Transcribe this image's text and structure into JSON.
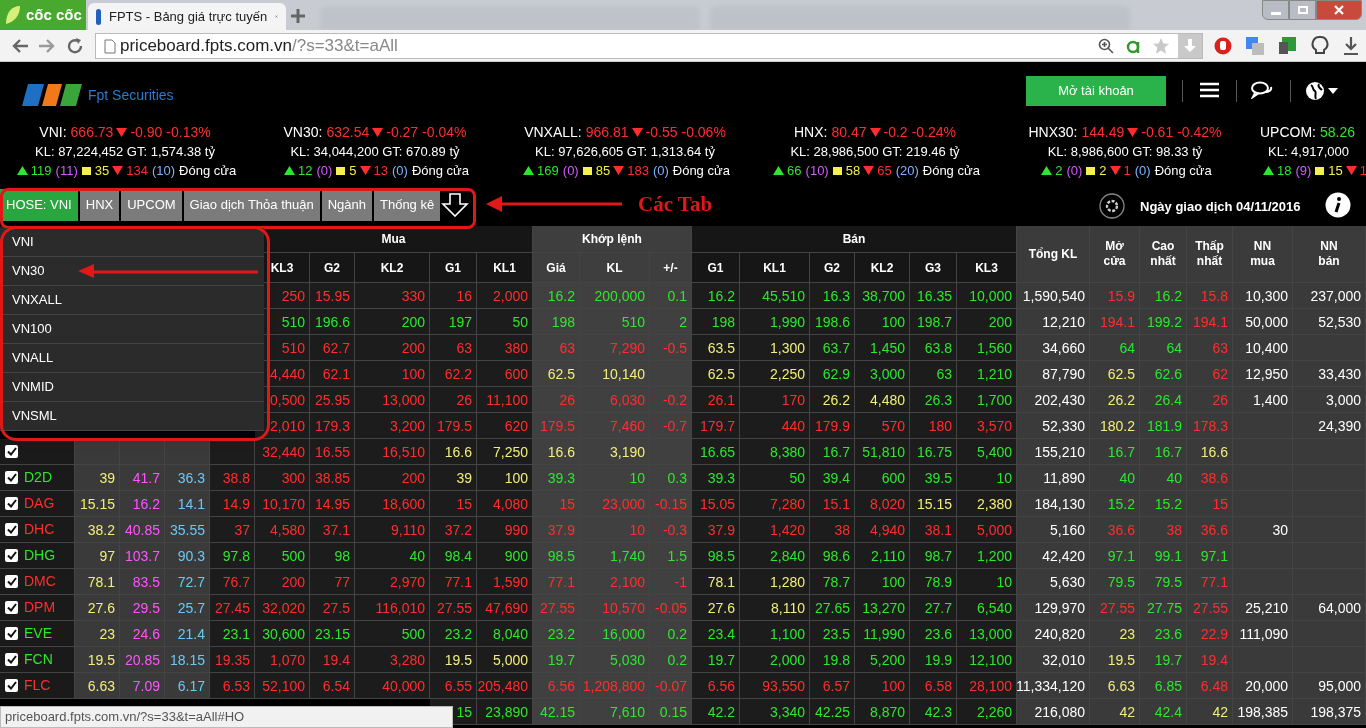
{
  "browser": {
    "logo_text": "cốc cốc",
    "tab_title": "FPTS - Bảng giá trực tuyến",
    "url_host": "priceboard.fpts.com.vn",
    "url_path": "/?s=33&t=aAll"
  },
  "header": {
    "logo_text": "Fpt Securities",
    "open_account": "Mở tài khoản"
  },
  "indices": [
    {
      "name": "VNI:",
      "value": "666.73",
      "rising": false,
      "change": "-0.90",
      "percent": "-0.13%",
      "volume_line": "KL: 87,224,452 GT: 1,574.38 tỷ",
      "advances": "119",
      "ceiling_count": "(11)",
      "unchanged": "35",
      "declines": "134",
      "floor_count": "(10)",
      "session": "Đóng cửa"
    },
    {
      "name": "VN30:",
      "value": "632.54",
      "rising": false,
      "change": "-0.27",
      "percent": "-0.04%",
      "volume_line": "KL: 34,044,200 GT: 670.89 tỷ",
      "advances": "12",
      "ceiling_count": "(0)",
      "unchanged": "5",
      "declines": "13",
      "floor_count": "(0)",
      "session": "Đóng cửa"
    },
    {
      "name": "VNXALL:",
      "value": "966.81",
      "rising": false,
      "change": "-0.55",
      "percent": "-0.06%",
      "volume_line": "KL: 97,626,605 GT: 1,313.64 tỷ",
      "advances": "169",
      "ceiling_count": "(0)",
      "unchanged": "85",
      "declines": "183",
      "floor_count": "(0)",
      "session": "Đóng cửa"
    },
    {
      "name": "HNX:",
      "value": "80.47",
      "rising": false,
      "change": "-0.2",
      "percent": "-0.24%",
      "volume_line": "KL: 28,986,500 GT: 219.46 tỷ",
      "advances": "66",
      "ceiling_count": "(10)",
      "unchanged": "58",
      "declines": "65",
      "floor_count": "(20)",
      "session": "Đóng cửa"
    },
    {
      "name": "HNX30:",
      "value": "144.49",
      "rising": false,
      "change": "-0.61",
      "percent": "-0.42%",
      "volume_line": "KL: 8,986,600 GT: 98.33 tỷ",
      "advances": "2",
      "ceiling_count": "(0)",
      "unchanged": "2",
      "declines": "1",
      "floor_count": "(0)",
      "session": "Đóng cửa"
    },
    {
      "name": "UPCOM:",
      "value": "58.26",
      "rising": true,
      "volume_line": "KL: 4,917,000",
      "advances": "18",
      "ceiling_count": "(9)",
      "unchanged": "15",
      "declines": "1"
    }
  ],
  "tabs": [
    {
      "label": "HOSE: VNI",
      "selected": true
    },
    {
      "label": "HNX",
      "selected": false
    },
    {
      "label": "UPCOM",
      "selected": false
    },
    {
      "label": "Giao dịch Thỏa thuận",
      "selected": false
    },
    {
      "label": "Ngành",
      "selected": false
    },
    {
      "label": "Thống kê",
      "selected": false
    }
  ],
  "annotation": "Các Tab",
  "trading_date": "Ngày giao dịch 04/11/2016",
  "dropdown": [
    "VNI",
    "VN30",
    "VNXALL",
    "VN100",
    "VNALL",
    "VNMID",
    "VNSML"
  ],
  "table": {
    "groups": [
      "Mua",
      "Khớp lệnh",
      "Bán"
    ],
    "columns": [
      null,
      null,
      null,
      null,
      "KL3",
      "G2",
      "KL2",
      "G1",
      "KL1",
      "Giá",
      "KL",
      "+/-",
      "G1",
      "KL1",
      "G2",
      "KL2",
      "G3",
      "KL3",
      "Tổng KL",
      "Mở cửa",
      "Cao nhất",
      "Thấp nhất",
      "NN mua",
      "NN bán"
    ],
    "rows": [
      {
        "cells": [
          null,
          null,
          null,
          null,
          {
            "text": "250",
            "color": "#ff2e2e"
          },
          {
            "text": "15.95",
            "color": "#ff2e2e"
          },
          {
            "text": "330",
            "color": "#ff2e2e"
          },
          {
            "text": "16",
            "color": "#ff2e2e"
          },
          {
            "text": "2,000",
            "color": "#ff2e2e"
          },
          {
            "text": "16.2",
            "color": "#2ee62e"
          },
          {
            "text": "200,000",
            "color": "#2ee62e"
          },
          {
            "text": "0.1",
            "color": "#2ee62e"
          },
          {
            "text": "16.2",
            "color": "#2ee62e"
          },
          {
            "text": "45,510",
            "color": "#2ee62e"
          },
          {
            "text": "16.3",
            "color": "#2ee62e"
          },
          {
            "text": "38,700",
            "color": "#2ee62e"
          },
          {
            "text": "16.35",
            "color": "#2ee62e"
          },
          {
            "text": "10,000",
            "color": "#2ee62e"
          },
          {
            "text": "1,590,540",
            "color": "#ffffff"
          },
          {
            "text": "15.9",
            "color": "#ff2e2e"
          },
          {
            "text": "16.2",
            "color": "#2ee62e"
          },
          {
            "text": "15.8",
            "color": "#ff2e2e"
          },
          {
            "text": "10,300",
            "color": "#ffffff"
          },
          {
            "text": "237,000",
            "color": "#ffffff"
          }
        ]
      },
      {
        "cells": [
          null,
          null,
          null,
          null,
          {
            "text": "510",
            "color": "#2ee62e"
          },
          {
            "text": "196.6",
            "color": "#2ee62e"
          },
          {
            "text": "200",
            "color": "#2ee62e"
          },
          {
            "text": "197",
            "color": "#2ee62e"
          },
          {
            "text": "50",
            "color": "#2ee62e"
          },
          {
            "text": "198",
            "color": "#2ee62e"
          },
          {
            "text": "510",
            "color": "#2ee62e"
          },
          {
            "text": "2",
            "color": "#2ee62e"
          },
          {
            "text": "198",
            "color": "#2ee62e"
          },
          {
            "text": "1,990",
            "color": "#2ee62e"
          },
          {
            "text": "198.6",
            "color": "#2ee62e"
          },
          {
            "text": "100",
            "color": "#2ee62e"
          },
          {
            "text": "198.7",
            "color": "#2ee62e"
          },
          {
            "text": "200",
            "color": "#2ee62e"
          },
          {
            "text": "12,210",
            "color": "#ffffff"
          },
          {
            "text": "194.1",
            "color": "#ff2e2e"
          },
          {
            "text": "199.2",
            "color": "#2ee62e"
          },
          {
            "text": "194.1",
            "color": "#ff2e2e"
          },
          {
            "text": "50,000",
            "color": "#ffffff"
          },
          {
            "text": "52,530",
            "color": "#ffffff"
          }
        ]
      },
      {
        "cells": [
          null,
          null,
          null,
          null,
          {
            "text": "510",
            "color": "#ff2e2e"
          },
          {
            "text": "62.7",
            "color": "#ff2e2e"
          },
          {
            "text": "200",
            "color": "#ff2e2e"
          },
          {
            "text": "63",
            "color": "#ff2e2e"
          },
          {
            "text": "380",
            "color": "#ff2e2e"
          },
          {
            "text": "63",
            "color": "#ff2e2e"
          },
          {
            "text": "7,290",
            "color": "#ff2e2e"
          },
          {
            "text": "-0.5",
            "color": "#ff2e2e"
          },
          {
            "text": "63.5",
            "color": "#f2ee7a"
          },
          {
            "text": "1,300",
            "color": "#f2ee7a"
          },
          {
            "text": "63.7",
            "color": "#2ee62e"
          },
          {
            "text": "1,450",
            "color": "#2ee62e"
          },
          {
            "text": "63.8",
            "color": "#2ee62e"
          },
          {
            "text": "1,560",
            "color": "#2ee62e"
          },
          {
            "text": "34,660",
            "color": "#ffffff"
          },
          {
            "text": "64",
            "color": "#2ee62e"
          },
          {
            "text": "64",
            "color": "#2ee62e"
          },
          {
            "text": "63",
            "color": "#ff2e2e"
          },
          {
            "text": "10,400",
            "color": "#ffffff"
          },
          null
        ]
      },
      {
        "cells": [
          null,
          null,
          null,
          null,
          {
            "text": "4,440",
            "color": "#ff2e2e"
          },
          {
            "text": "62.1",
            "color": "#ff2e2e"
          },
          {
            "text": "100",
            "color": "#ff2e2e"
          },
          {
            "text": "62.2",
            "color": "#ff2e2e"
          },
          {
            "text": "600",
            "color": "#ff2e2e"
          },
          {
            "text": "62.5",
            "color": "#f2ee7a"
          },
          {
            "text": "10,140",
            "color": "#f2ee7a"
          },
          null,
          {
            "text": "62.5",
            "color": "#f2ee7a"
          },
          {
            "text": "2,250",
            "color": "#f2ee7a"
          },
          {
            "text": "62.9",
            "color": "#2ee62e"
          },
          {
            "text": "3,000",
            "color": "#2ee62e"
          },
          {
            "text": "63",
            "color": "#2ee62e"
          },
          {
            "text": "1,210",
            "color": "#2ee62e"
          },
          {
            "text": "87,790",
            "color": "#ffffff"
          },
          {
            "text": "62.5",
            "color": "#f2ee7a"
          },
          {
            "text": "62.6",
            "color": "#2ee62e"
          },
          {
            "text": "62",
            "color": "#ff2e2e"
          },
          {
            "text": "12,950",
            "color": "#ffffff"
          },
          {
            "text": "33,430",
            "color": "#ffffff"
          }
        ]
      },
      {
        "cells": [
          null,
          null,
          null,
          null,
          {
            "text": "0,500",
            "color": "#ff2e2e"
          },
          {
            "text": "25.95",
            "color": "#ff2e2e"
          },
          {
            "text": "13,000",
            "color": "#ff2e2e"
          },
          {
            "text": "26",
            "color": "#ff2e2e"
          },
          {
            "text": "11,100",
            "color": "#ff2e2e"
          },
          {
            "text": "26",
            "color": "#ff2e2e"
          },
          {
            "text": "6,030",
            "color": "#ff2e2e"
          },
          {
            "text": "-0.2",
            "color": "#ff2e2e"
          },
          {
            "text": "26.1",
            "color": "#ff2e2e"
          },
          {
            "text": "170",
            "color": "#ff2e2e"
          },
          {
            "text": "26.2",
            "color": "#f2ee7a"
          },
          {
            "text": "4,480",
            "color": "#f2ee7a"
          },
          {
            "text": "26.3",
            "color": "#2ee62e"
          },
          {
            "text": "1,700",
            "color": "#2ee62e"
          },
          {
            "text": "202,430",
            "color": "#ffffff"
          },
          {
            "text": "26.2",
            "color": "#f2ee7a"
          },
          {
            "text": "26.4",
            "color": "#2ee62e"
          },
          {
            "text": "26",
            "color": "#ff2e2e"
          },
          {
            "text": "1,400",
            "color": "#ffffff"
          },
          {
            "text": "3,000",
            "color": "#ffffff"
          }
        ]
      },
      {
        "cells": [
          null,
          null,
          null,
          null,
          {
            "text": "2,010",
            "color": "#ff2e2e"
          },
          {
            "text": "179.3",
            "color": "#ff2e2e"
          },
          {
            "text": "3,200",
            "color": "#ff2e2e"
          },
          {
            "text": "179.5",
            "color": "#ff2e2e"
          },
          {
            "text": "620",
            "color": "#ff2e2e"
          },
          {
            "text": "179.5",
            "color": "#ff2e2e"
          },
          {
            "text": "7,460",
            "color": "#ff2e2e"
          },
          {
            "text": "-0.7",
            "color": "#ff2e2e"
          },
          {
            "text": "179.7",
            "color": "#ff2e2e"
          },
          {
            "text": "440",
            "color": "#ff2e2e"
          },
          {
            "text": "179.9",
            "color": "#ff2e2e"
          },
          {
            "text": "570",
            "color": "#ff2e2e"
          },
          {
            "text": "180",
            "color": "#ff2e2e"
          },
          {
            "text": "3,570",
            "color": "#ff2e2e"
          },
          {
            "text": "52,330",
            "color": "#ffffff"
          },
          {
            "text": "180.2",
            "color": "#f2ee7a"
          },
          {
            "text": "181.9",
            "color": "#2ee62e"
          },
          {
            "text": "178.3",
            "color": "#ff2e2e"
          },
          null,
          {
            "text": "24,390",
            "color": "#ffffff"
          }
        ]
      },
      {
        "checked": true,
        "cells": [
          null,
          null,
          null,
          null,
          {
            "text": "32,440",
            "color": "#ff2e2e"
          },
          {
            "text": "16.55",
            "color": "#ff2e2e"
          },
          {
            "text": "16,510",
            "color": "#ff2e2e"
          },
          {
            "text": "16.6",
            "color": "#f2ee7a"
          },
          {
            "text": "7,250",
            "color": "#f2ee7a"
          },
          {
            "text": "16.6",
            "color": "#f2ee7a"
          },
          {
            "text": "3,190",
            "color": "#f2ee7a"
          },
          null,
          {
            "text": "16.65",
            "color": "#2ee62e"
          },
          {
            "text": "8,380",
            "color": "#2ee62e"
          },
          {
            "text": "16.7",
            "color": "#2ee62e"
          },
          {
            "text": "51,810",
            "color": "#2ee62e"
          },
          {
            "text": "16.75",
            "color": "#2ee62e"
          },
          {
            "text": "5,400",
            "color": "#2ee62e"
          },
          {
            "text": "155,210",
            "color": "#ffffff"
          },
          {
            "text": "16.7",
            "color": "#2ee62e"
          },
          {
            "text": "16.7",
            "color": "#2ee62e"
          },
          {
            "text": "16.6",
            "color": "#f2ee7a"
          },
          null,
          null
        ]
      },
      {
        "checked": true,
        "symbol": "D2D",
        "color": "#2ee62e",
        "cells": [
          {
            "text": "39",
            "color": "#f2ee7a"
          },
          {
            "text": "41.7",
            "color": "#ff55ff"
          },
          {
            "text": "36.3",
            "color": "#6cc8f5"
          },
          {
            "text": "38.8",
            "color": "#ff2e2e"
          },
          {
            "text": "300",
            "color": "#ff2e2e"
          },
          {
            "text": "38.85",
            "color": "#ff2e2e"
          },
          {
            "text": "200",
            "color": "#ff2e2e"
          },
          {
            "text": "39",
            "color": "#f2ee7a"
          },
          {
            "text": "100",
            "color": "#f2ee7a"
          },
          {
            "text": "39.3",
            "color": "#2ee62e"
          },
          {
            "text": "10",
            "color": "#2ee62e"
          },
          {
            "text": "0.3",
            "color": "#2ee62e"
          },
          {
            "text": "39.3",
            "color": "#2ee62e"
          },
          {
            "text": "50",
            "color": "#2ee62e"
          },
          {
            "text": "39.4",
            "color": "#2ee62e"
          },
          {
            "text": "600",
            "color": "#2ee62e"
          },
          {
            "text": "39.5",
            "color": "#2ee62e"
          },
          {
            "text": "10",
            "color": "#2ee62e"
          },
          {
            "text": "11,890",
            "color": "#ffffff"
          },
          {
            "text": "40",
            "color": "#2ee62e"
          },
          {
            "text": "40",
            "color": "#2ee62e"
          },
          {
            "text": "38.6",
            "color": "#ff2e2e"
          },
          null,
          null
        ]
      },
      {
        "checked": true,
        "symbol": "DAG",
        "color": "#ff2e2e",
        "cells": [
          {
            "text": "15.15",
            "color": "#f2ee7a"
          },
          {
            "text": "16.2",
            "color": "#ff55ff"
          },
          {
            "text": "14.1",
            "color": "#6cc8f5"
          },
          {
            "text": "14.9",
            "color": "#ff2e2e"
          },
          {
            "text": "10,170",
            "color": "#ff2e2e"
          },
          {
            "text": "14.95",
            "color": "#ff2e2e"
          },
          {
            "text": "18,600",
            "color": "#ff2e2e"
          },
          {
            "text": "15",
            "color": "#ff2e2e"
          },
          {
            "text": "4,080",
            "color": "#ff2e2e"
          },
          {
            "text": "15",
            "color": "#ff2e2e"
          },
          {
            "text": "23,000",
            "color": "#ff2e2e"
          },
          {
            "text": "-0.15",
            "color": "#ff2e2e"
          },
          {
            "text": "15.05",
            "color": "#ff2e2e"
          },
          {
            "text": "7,280",
            "color": "#ff2e2e"
          },
          {
            "text": "15.1",
            "color": "#ff2e2e"
          },
          {
            "text": "8,020",
            "color": "#ff2e2e"
          },
          {
            "text": "15.15",
            "color": "#f2ee7a"
          },
          {
            "text": "2,380",
            "color": "#f2ee7a"
          },
          {
            "text": "184,130",
            "color": "#ffffff"
          },
          {
            "text": "15.2",
            "color": "#2ee62e"
          },
          {
            "text": "15.2",
            "color": "#2ee62e"
          },
          {
            "text": "15",
            "color": "#ff2e2e"
          },
          null,
          null
        ]
      },
      {
        "checked": true,
        "symbol": "DHC",
        "color": "#ff2e2e",
        "cells": [
          {
            "text": "38.2",
            "color": "#f2ee7a"
          },
          {
            "text": "40.85",
            "color": "#ff55ff"
          },
          {
            "text": "35.55",
            "color": "#6cc8f5"
          },
          {
            "text": "37",
            "color": "#ff2e2e"
          },
          {
            "text": "4,580",
            "color": "#ff2e2e"
          },
          {
            "text": "37.1",
            "color": "#ff2e2e"
          },
          {
            "text": "9,110",
            "color": "#ff2e2e"
          },
          {
            "text": "37.2",
            "color": "#ff2e2e"
          },
          {
            "text": "990",
            "color": "#ff2e2e"
          },
          {
            "text": "37.9",
            "color": "#ff2e2e"
          },
          {
            "text": "10",
            "color": "#ff2e2e"
          },
          {
            "text": "-0.3",
            "color": "#ff2e2e"
          },
          {
            "text": "37.9",
            "color": "#ff2e2e"
          },
          {
            "text": "1,420",
            "color": "#ff2e2e"
          },
          {
            "text": "38",
            "color": "#ff2e2e"
          },
          {
            "text": "4,940",
            "color": "#ff2e2e"
          },
          {
            "text": "38.1",
            "color": "#ff2e2e"
          },
          {
            "text": "5,000",
            "color": "#ff2e2e"
          },
          {
            "text": "5,160",
            "color": "#ffffff"
          },
          {
            "text": "36.6",
            "color": "#ff2e2e"
          },
          {
            "text": "38",
            "color": "#ff2e2e"
          },
          {
            "text": "36.6",
            "color": "#ff2e2e"
          },
          {
            "text": "30",
            "color": "#ffffff"
          },
          null
        ]
      },
      {
        "checked": true,
        "symbol": "DHG",
        "color": "#2ee62e",
        "cells": [
          {
            "text": "97",
            "color": "#f2ee7a"
          },
          {
            "text": "103.7",
            "color": "#ff55ff"
          },
          {
            "text": "90.3",
            "color": "#6cc8f5"
          },
          {
            "text": "97.8",
            "color": "#2ee62e"
          },
          {
            "text": "500",
            "color": "#2ee62e"
          },
          {
            "text": "98",
            "color": "#2ee62e"
          },
          {
            "text": "40",
            "color": "#2ee62e"
          },
          {
            "text": "98.4",
            "color": "#2ee62e"
          },
          {
            "text": "900",
            "color": "#2ee62e"
          },
          {
            "text": "98.5",
            "color": "#2ee62e"
          },
          {
            "text": "1,740",
            "color": "#2ee62e"
          },
          {
            "text": "1.5",
            "color": "#2ee62e"
          },
          {
            "text": "98.5",
            "color": "#2ee62e"
          },
          {
            "text": "2,840",
            "color": "#2ee62e"
          },
          {
            "text": "98.6",
            "color": "#2ee62e"
          },
          {
            "text": "2,110",
            "color": "#2ee62e"
          },
          {
            "text": "98.7",
            "color": "#2ee62e"
          },
          {
            "text": "1,200",
            "color": "#2ee62e"
          },
          {
            "text": "42,420",
            "color": "#ffffff"
          },
          {
            "text": "97.1",
            "color": "#2ee62e"
          },
          {
            "text": "99.1",
            "color": "#2ee62e"
          },
          {
            "text": "97.1",
            "color": "#2ee62e"
          },
          null,
          null
        ]
      },
      {
        "checked": true,
        "symbol": "DMC",
        "color": "#ff2e2e",
        "cells": [
          {
            "text": "78.1",
            "color": "#f2ee7a"
          },
          {
            "text": "83.5",
            "color": "#ff55ff"
          },
          {
            "text": "72.7",
            "color": "#6cc8f5"
          },
          {
            "text": "76.7",
            "color": "#ff2e2e"
          },
          {
            "text": "200",
            "color": "#ff2e2e"
          },
          {
            "text": "77",
            "color": "#ff2e2e"
          },
          {
            "text": "2,970",
            "color": "#ff2e2e"
          },
          {
            "text": "77.1",
            "color": "#ff2e2e"
          },
          {
            "text": "1,590",
            "color": "#ff2e2e"
          },
          {
            "text": "77.1",
            "color": "#ff2e2e"
          },
          {
            "text": "2,100",
            "color": "#ff2e2e"
          },
          {
            "text": "-1",
            "color": "#ff2e2e"
          },
          {
            "text": "78.1",
            "color": "#f2ee7a"
          },
          {
            "text": "1,280",
            "color": "#f2ee7a"
          },
          {
            "text": "78.7",
            "color": "#2ee62e"
          },
          {
            "text": "100",
            "color": "#2ee62e"
          },
          {
            "text": "78.9",
            "color": "#2ee62e"
          },
          {
            "text": "10",
            "color": "#2ee62e"
          },
          {
            "text": "5,630",
            "color": "#ffffff"
          },
          {
            "text": "79.5",
            "color": "#2ee62e"
          },
          {
            "text": "79.5",
            "color": "#2ee62e"
          },
          {
            "text": "77.1",
            "color": "#ff2e2e"
          },
          null,
          null
        ]
      },
      {
        "checked": true,
        "symbol": "DPM",
        "color": "#ff2e2e",
        "cells": [
          {
            "text": "27.6",
            "color": "#f2ee7a"
          },
          {
            "text": "29.5",
            "color": "#ff55ff"
          },
          {
            "text": "25.7",
            "color": "#6cc8f5"
          },
          {
            "text": "27.45",
            "color": "#ff2e2e"
          },
          {
            "text": "32,020",
            "color": "#ff2e2e"
          },
          {
            "text": "27.5",
            "color": "#ff2e2e"
          },
          {
            "text": "116,010",
            "color": "#ff2e2e"
          },
          {
            "text": "27.55",
            "color": "#ff2e2e"
          },
          {
            "text": "47,690",
            "color": "#ff2e2e"
          },
          {
            "text": "27.55",
            "color": "#ff2e2e"
          },
          {
            "text": "10,570",
            "color": "#ff2e2e"
          },
          {
            "text": "-0.05",
            "color": "#ff2e2e"
          },
          {
            "text": "27.6",
            "color": "#f2ee7a"
          },
          {
            "text": "8,110",
            "color": "#f2ee7a"
          },
          {
            "text": "27.65",
            "color": "#2ee62e"
          },
          {
            "text": "13,270",
            "color": "#2ee62e"
          },
          {
            "text": "27.7",
            "color": "#2ee62e"
          },
          {
            "text": "6,540",
            "color": "#2ee62e"
          },
          {
            "text": "129,970",
            "color": "#ffffff"
          },
          {
            "text": "27.55",
            "color": "#ff2e2e"
          },
          {
            "text": "27.75",
            "color": "#2ee62e"
          },
          {
            "text": "27.55",
            "color": "#ff2e2e"
          },
          {
            "text": "25,210",
            "color": "#ffffff"
          },
          {
            "text": "64,000",
            "color": "#ffffff"
          }
        ]
      },
      {
        "checked": true,
        "symbol": "EVE",
        "color": "#2ee62e",
        "cells": [
          {
            "text": "23",
            "color": "#f2ee7a"
          },
          {
            "text": "24.6",
            "color": "#ff55ff"
          },
          {
            "text": "21.4",
            "color": "#6cc8f5"
          },
          {
            "text": "23.1",
            "color": "#2ee62e"
          },
          {
            "text": "30,600",
            "color": "#2ee62e"
          },
          {
            "text": "23.15",
            "color": "#2ee62e"
          },
          {
            "text": "500",
            "color": "#2ee62e"
          },
          {
            "text": "23.2",
            "color": "#2ee62e"
          },
          {
            "text": "8,040",
            "color": "#2ee62e"
          },
          {
            "text": "23.2",
            "color": "#2ee62e"
          },
          {
            "text": "16,000",
            "color": "#2ee62e"
          },
          {
            "text": "0.2",
            "color": "#2ee62e"
          },
          {
            "text": "23.4",
            "color": "#2ee62e"
          },
          {
            "text": "1,100",
            "color": "#2ee62e"
          },
          {
            "text": "23.5",
            "color": "#2ee62e"
          },
          {
            "text": "11,990",
            "color": "#2ee62e"
          },
          {
            "text": "23.6",
            "color": "#2ee62e"
          },
          {
            "text": "13,000",
            "color": "#2ee62e"
          },
          {
            "text": "240,820",
            "color": "#ffffff"
          },
          {
            "text": "23",
            "color": "#f2ee7a"
          },
          {
            "text": "23.6",
            "color": "#2ee62e"
          },
          {
            "text": "22.9",
            "color": "#ff2e2e"
          },
          {
            "text": "111,090",
            "color": "#ffffff"
          },
          null
        ]
      },
      {
        "checked": true,
        "symbol": "FCN",
        "color": "#2ee62e",
        "cells": [
          {
            "text": "19.5",
            "color": "#f2ee7a"
          },
          {
            "text": "20.85",
            "color": "#ff55ff"
          },
          {
            "text": "18.15",
            "color": "#6cc8f5"
          },
          {
            "text": "19.35",
            "color": "#ff2e2e"
          },
          {
            "text": "1,070",
            "color": "#ff2e2e"
          },
          {
            "text": "19.4",
            "color": "#ff2e2e"
          },
          {
            "text": "3,280",
            "color": "#ff2e2e"
          },
          {
            "text": "19.5",
            "color": "#f2ee7a"
          },
          {
            "text": "5,000",
            "color": "#f2ee7a"
          },
          {
            "text": "19.7",
            "color": "#2ee62e"
          },
          {
            "text": "5,030",
            "color": "#2ee62e"
          },
          {
            "text": "0.2",
            "color": "#2ee62e"
          },
          {
            "text": "19.7",
            "color": "#2ee62e"
          },
          {
            "text": "2,000",
            "color": "#2ee62e"
          },
          {
            "text": "19.8",
            "color": "#2ee62e"
          },
          {
            "text": "5,200",
            "color": "#2ee62e"
          },
          {
            "text": "19.9",
            "color": "#2ee62e"
          },
          {
            "text": "12,100",
            "color": "#2ee62e"
          },
          {
            "text": "32,010",
            "color": "#ffffff"
          },
          {
            "text": "19.5",
            "color": "#f2ee7a"
          },
          {
            "text": "19.7",
            "color": "#2ee62e"
          },
          {
            "text": "19.4",
            "color": "#ff2e2e"
          },
          null,
          null
        ]
      },
      {
        "checked": true,
        "symbol": "FLC",
        "color": "#ff2e2e",
        "cells": [
          {
            "text": "6.63",
            "color": "#f2ee7a"
          },
          {
            "text": "7.09",
            "color": "#ff55ff"
          },
          {
            "text": "6.17",
            "color": "#6cc8f5"
          },
          {
            "text": "6.53",
            "color": "#ff2e2e"
          },
          {
            "text": "52,100",
            "color": "#ff2e2e"
          },
          {
            "text": "6.54",
            "color": "#ff2e2e"
          },
          {
            "text": "40,000",
            "color": "#ff2e2e"
          },
          {
            "text": "6.55",
            "color": "#ff2e2e"
          },
          {
            "text": "205,480",
            "color": "#ff2e2e"
          },
          {
            "text": "6.56",
            "color": "#ff2e2e"
          },
          {
            "text": "1,208,800",
            "color": "#ff2e2e"
          },
          {
            "text": "-0.07",
            "color": "#ff2e2e"
          },
          {
            "text": "6.56",
            "color": "#ff2e2e"
          },
          {
            "text": "93,550",
            "color": "#ff2e2e"
          },
          {
            "text": "6.57",
            "color": "#ff2e2e"
          },
          {
            "text": "100",
            "color": "#ff2e2e"
          },
          {
            "text": "6.58",
            "color": "#ff2e2e"
          },
          {
            "text": "28,100",
            "color": "#ff2e2e"
          },
          {
            "text": "11,334,120",
            "color": "#ffffff"
          },
          {
            "text": "6.63",
            "color": "#f2ee7a"
          },
          {
            "text": "6.85",
            "color": "#2ee62e"
          },
          {
            "text": "6.48",
            "color": "#ff2e2e"
          },
          {
            "text": "20,000",
            "color": "#ffffff"
          },
          {
            "text": "95,000",
            "color": "#ffffff"
          }
        ]
      },
      {
        "cells": [
          null,
          null,
          null,
          null,
          null,
          null,
          null,
          {
            "text": "15",
            "color": "#2ee62e"
          },
          {
            "text": "23,890",
            "color": "#2ee62e"
          },
          {
            "text": "42.15",
            "color": "#2ee62e"
          },
          {
            "text": "7,610",
            "color": "#2ee62e"
          },
          {
            "text": "0.15",
            "color": "#2ee62e"
          },
          {
            "text": "42.2",
            "color": "#2ee62e"
          },
          {
            "text": "3,340",
            "color": "#2ee62e"
          },
          {
            "text": "42.25",
            "color": "#2ee62e"
          },
          {
            "text": "8,870",
            "color": "#2ee62e"
          },
          {
            "text": "42.3",
            "color": "#2ee62e"
          },
          {
            "text": "2,260",
            "color": "#2ee62e"
          },
          {
            "text": "216,080",
            "color": "#ffffff"
          },
          {
            "text": "42",
            "color": "#f2ee7a"
          },
          {
            "text": "42.4",
            "color": "#2ee62e"
          },
          {
            "text": "42",
            "color": "#f2ee7a"
          },
          {
            "text": "198,385",
            "color": "#ffffff"
          },
          {
            "text": "198,375",
            "color": "#ffffff"
          }
        ]
      }
    ]
  },
  "status_url": "priceboard.fpts.com.vn/?s=33&t=aAll#HO"
}
